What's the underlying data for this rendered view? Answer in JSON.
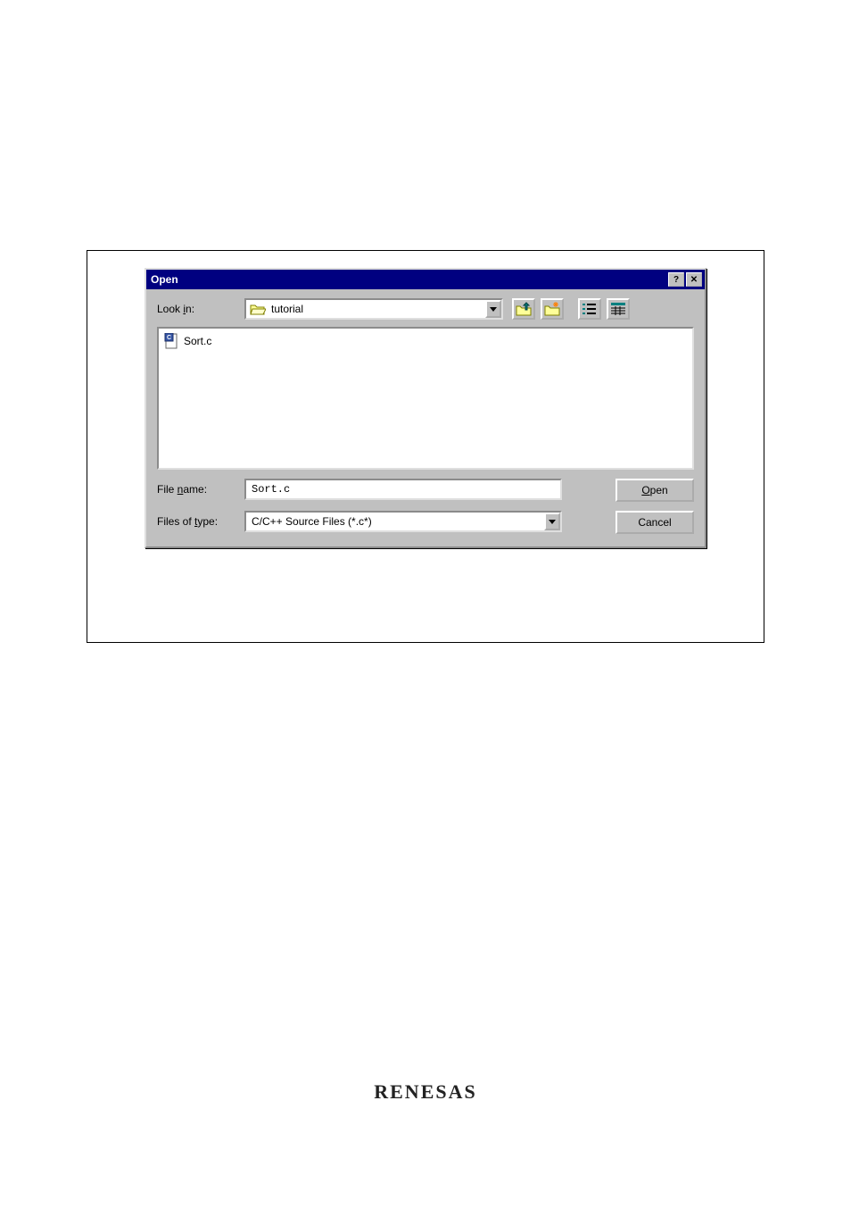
{
  "dialog": {
    "title": "Open",
    "lookin_label_pre": "Look ",
    "lookin_label_u": "i",
    "lookin_label_post": "n:",
    "lookin_value": "tutorial",
    "toolbar_icons": {
      "up": "up-one-level-icon",
      "new_folder": "create-new-folder-icon",
      "list": "list-view-icon",
      "details": "details-view-icon"
    },
    "file_list": [
      {
        "name": "Sort.c",
        "icon": "c-source-file-icon"
      }
    ],
    "filename_label_pre": "File ",
    "filename_label_u": "n",
    "filename_label_post": "ame:",
    "filename_value": "Sort.c",
    "filetype_label_pre": "Files of ",
    "filetype_label_u": "t",
    "filetype_label_post": "ype:",
    "filetype_value": "C/C++ Source Files (*.c*)",
    "open_button_u": "O",
    "open_button_rest": "pen",
    "cancel_button": "Cancel"
  },
  "footer": {
    "logo_text": "RENESAS"
  }
}
